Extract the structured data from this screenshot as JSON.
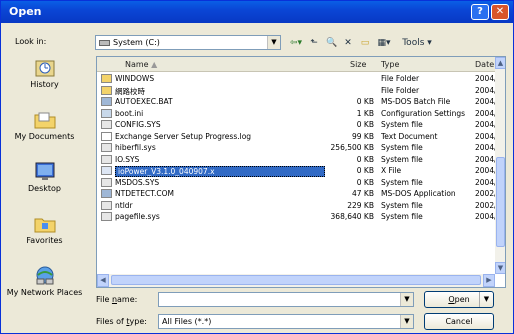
{
  "window": {
    "title": "Open"
  },
  "lookin": {
    "label": "Look in:",
    "value": "System (C:)"
  },
  "toolbar": {
    "tools_label": "Tools"
  },
  "places": [
    {
      "label": "History",
      "icon": "history-icon"
    },
    {
      "label": "My Documents",
      "icon": "documents-folder-icon"
    },
    {
      "label": "Desktop",
      "icon": "desktop-icon"
    },
    {
      "label": "Favorites",
      "icon": "favorites-folder-icon"
    },
    {
      "label": "My Network Places",
      "icon": "network-places-icon"
    }
  ],
  "columns": {
    "name": "Name",
    "size": "Size",
    "type": "Type",
    "date": "Date"
  },
  "files": [
    {
      "name": "WINDOWS",
      "size": "",
      "type": "File Folder",
      "date": "2004/",
      "icon": "folder"
    },
    {
      "name": "網路校時",
      "size": "",
      "type": "File Folder",
      "date": "2004/",
      "icon": "folder"
    },
    {
      "name": "AUTOEXEC.BAT",
      "size": "0 KB",
      "type": "MS-DOS Batch File",
      "date": "2004/",
      "icon": "batch"
    },
    {
      "name": "boot.ini",
      "size": "1 KB",
      "type": "Configuration Settings",
      "date": "2004/",
      "icon": "ini"
    },
    {
      "name": "CONFIG.SYS",
      "size": "0 KB",
      "type": "System file",
      "date": "2004/",
      "icon": "sys"
    },
    {
      "name": "Exchange Server Setup Progress.log",
      "size": "99 KB",
      "type": "Text Document",
      "date": "2004/",
      "icon": "txt"
    },
    {
      "name": "hiberfil.sys",
      "size": "256,500 KB",
      "type": "System file",
      "date": "2004/",
      "icon": "sys"
    },
    {
      "name": "IO.SYS",
      "size": "0 KB",
      "type": "System file",
      "date": "2004/",
      "icon": "sys"
    },
    {
      "name": "ioPower_V3.1.0_040907.x",
      "size": "0 KB",
      "type": "X File",
      "date": "2004/",
      "icon": "file",
      "selected": true
    },
    {
      "name": "MSDOS.SYS",
      "size": "0 KB",
      "type": "System file",
      "date": "2004/",
      "icon": "sys"
    },
    {
      "name": "NTDETECT.COM",
      "size": "47 KB",
      "type": "MS-DOS Application",
      "date": "2002/",
      "icon": "com"
    },
    {
      "name": "ntldr",
      "size": "229 KB",
      "type": "System file",
      "date": "2002/",
      "icon": "sys"
    },
    {
      "name": "pagefile.sys",
      "size": "368,640 KB",
      "type": "System file",
      "date": "2004/",
      "icon": "sys"
    }
  ],
  "filename": {
    "label_pre": "File ",
    "label_u": "n",
    "label_post": "ame:",
    "value": ""
  },
  "filetype": {
    "label_pre": "Files of ",
    "label_u": "t",
    "label_post": "ype:",
    "value": "All Files (*.*)"
  },
  "buttons": {
    "open_u": "O",
    "open_rest": "pen",
    "cancel": "Cancel"
  }
}
